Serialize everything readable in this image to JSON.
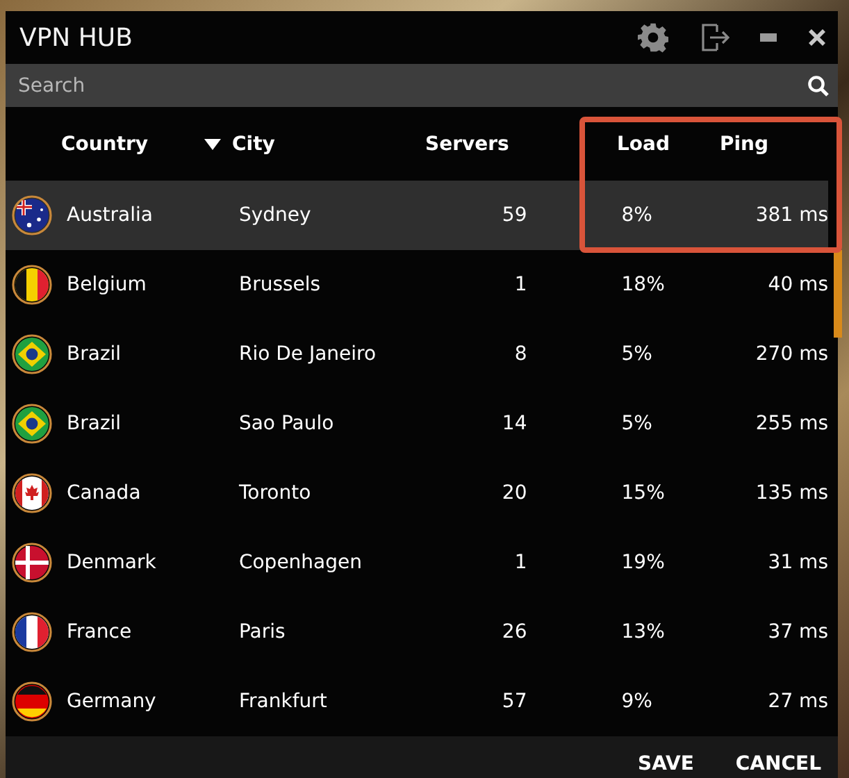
{
  "window": {
    "title": "VPN HUB"
  },
  "search": {
    "placeholder": "Search"
  },
  "table": {
    "columns": [
      {
        "label": "Country",
        "sorted": false
      },
      {
        "label": "City",
        "sorted": true
      },
      {
        "label": "Servers",
        "sorted": false
      },
      {
        "label": "Load",
        "sorted": false
      },
      {
        "label": "Ping",
        "sorted": false
      }
    ],
    "rows": [
      {
        "kind": "au",
        "country": "Australia",
        "city": "Sydney",
        "servers": "59",
        "load": "8%",
        "ping": "381 ms",
        "selected": true
      },
      {
        "kind": "be",
        "country": "Belgium",
        "city": "Brussels",
        "servers": "1",
        "load": "18%",
        "ping": "40 ms",
        "selected": false
      },
      {
        "kind": "br",
        "country": "Brazil",
        "city": "Rio De Janeiro",
        "servers": "8",
        "load": "5%",
        "ping": "270 ms",
        "selected": false
      },
      {
        "kind": "br",
        "country": "Brazil",
        "city": "Sao Paulo",
        "servers": "14",
        "load": "5%",
        "ping": "255 ms",
        "selected": false
      },
      {
        "kind": "ca",
        "country": "Canada",
        "city": "Toronto",
        "servers": "20",
        "load": "15%",
        "ping": "135 ms",
        "selected": false
      },
      {
        "kind": "dk",
        "country": "Denmark",
        "city": "Copenhagen",
        "servers": "1",
        "load": "19%",
        "ping": "31 ms",
        "selected": false
      },
      {
        "kind": "fr",
        "country": "France",
        "city": "Paris",
        "servers": "26",
        "load": "13%",
        "ping": "37 ms",
        "selected": false
      },
      {
        "kind": "de",
        "country": "Germany",
        "city": "Frankfurt",
        "servers": "57",
        "load": "9%",
        "ping": "27 ms",
        "selected": false
      }
    ]
  },
  "buttons": [
    "SAVE",
    "CANCEL"
  ]
}
